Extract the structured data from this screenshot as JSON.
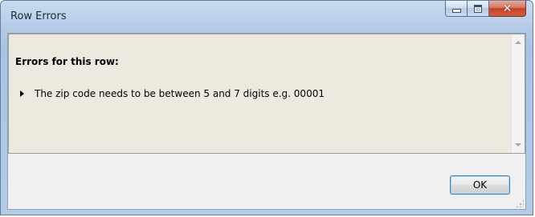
{
  "window": {
    "title": "Row Errors"
  },
  "caption_buttons": {
    "minimize_icon": "minimize-icon",
    "maximize_icon": "maximize-icon",
    "close_icon": "close-icon",
    "close_glyph": "✕"
  },
  "errors": {
    "heading": "Errors for this row:",
    "items": [
      {
        "text": "The zip code needs to be between 5 and 7 digits e.g. 00001"
      }
    ]
  },
  "buttons": {
    "ok_label": "OK"
  },
  "colors": {
    "content_background": "#eceadf",
    "close_button": "#c24325",
    "ok_focus_border": "#3c7fb1"
  }
}
